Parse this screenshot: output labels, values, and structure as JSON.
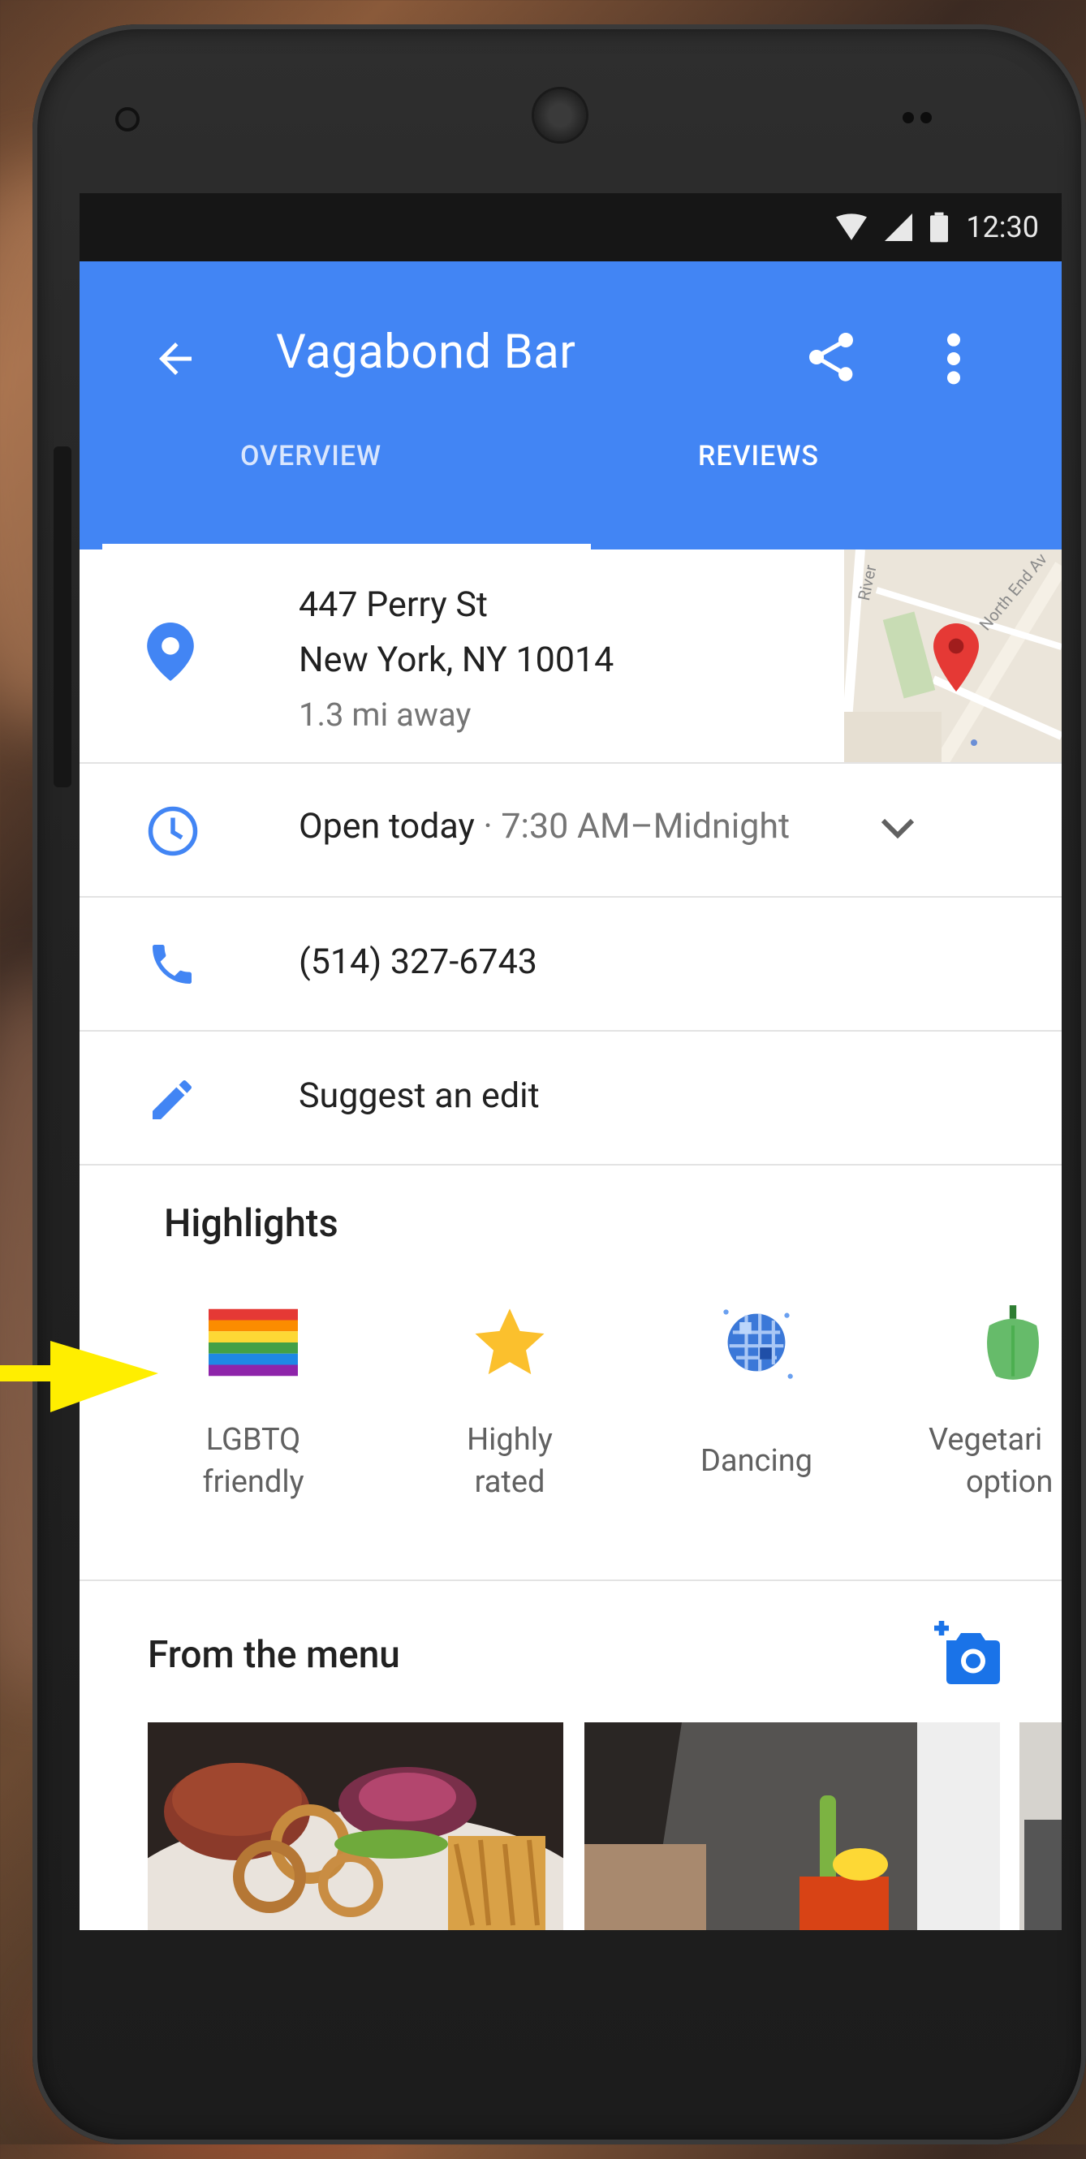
{
  "status_bar": {
    "time": "12:30"
  },
  "app_bar": {
    "title": "Vagabond Bar",
    "tabs": [
      {
        "label": "OVERVIEW",
        "selected": true
      },
      {
        "label": "REVIEWS",
        "selected": false
      }
    ],
    "accent": "#4285f4"
  },
  "address": {
    "line1": "447 Perry St",
    "line2": "New York, NY 10014",
    "distance": "1.3 mi away",
    "map_street_labels": [
      "River",
      "North End Av"
    ]
  },
  "hours": {
    "status": "Open today",
    "separator": " · ",
    "range": "7:30 AM–Midnight"
  },
  "phone": {
    "number": "(514) 327-6743"
  },
  "suggest_edit": {
    "label": "Suggest an edit"
  },
  "highlights": {
    "title": "Highlights",
    "items": [
      {
        "line1": "LGBTQ",
        "line2": "friendly",
        "icon": "rainbow-flag-icon"
      },
      {
        "line1": "Highly",
        "line2": "rated",
        "icon": "star-icon"
      },
      {
        "line1": "Dancing",
        "line2": "",
        "icon": "disco-ball-icon"
      },
      {
        "line1": "Vegetari",
        "line2": "option",
        "icon": "pepper-icon"
      }
    ]
  },
  "menu": {
    "title": "From the menu"
  }
}
